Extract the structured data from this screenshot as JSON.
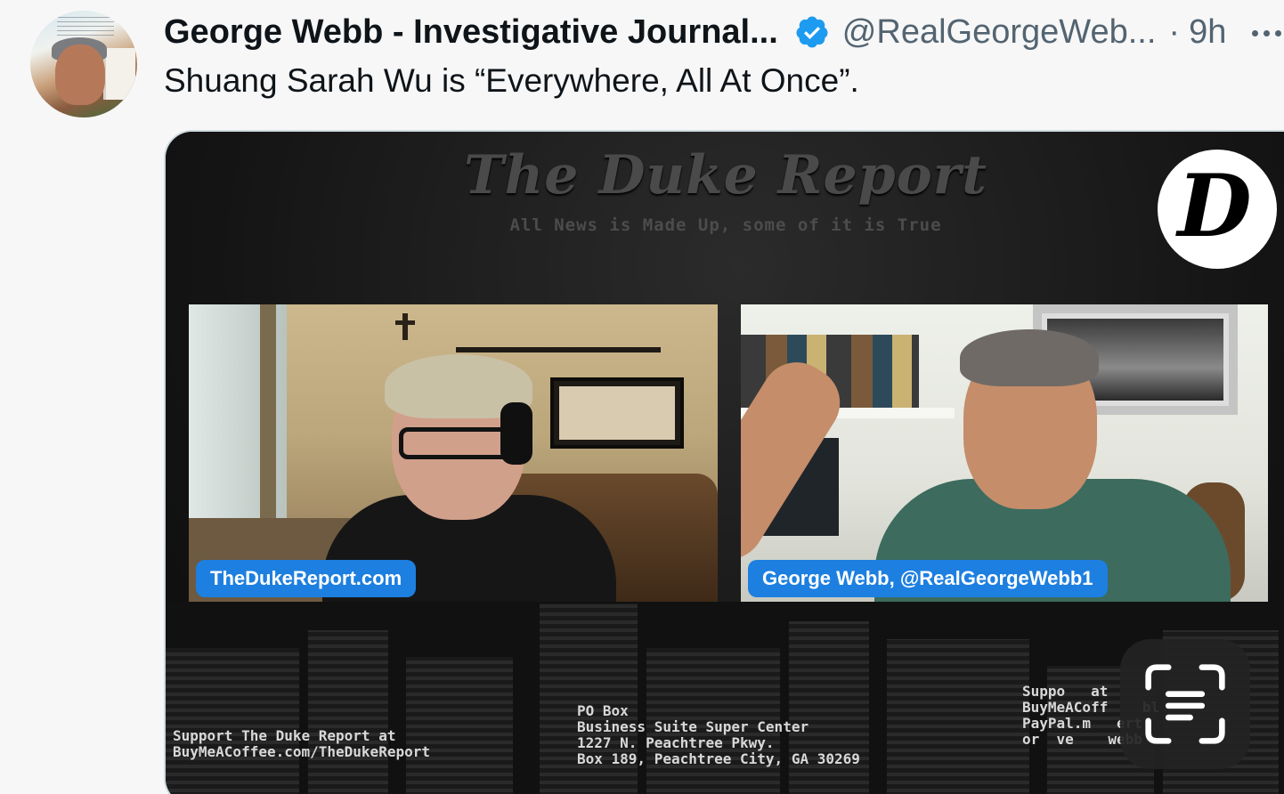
{
  "tweet": {
    "author_name": "George Webb - Investigative Journal...",
    "handle": "@RealGeorgeWeb...",
    "separator": "·",
    "time": "9h",
    "text": "Shuang Sarah Wu is “Everywhere, All At Once”."
  },
  "icons": {
    "verified": "verified-badge-icon",
    "more": "more-options-icon",
    "scan": "text-scan-icon",
    "verified_color": "#1d9bf0"
  },
  "media": {
    "show_title": "The Duke Report",
    "tagline": "All News is Made Up, some of it is True",
    "logo_letter": "D",
    "left_label": "TheDukeReport.com",
    "right_label": "George Webb, @RealGeorgeWebb1",
    "footer_left": "Support The Duke Report at\nBuyMeACoffee.com/TheDukeReport",
    "footer_mid": "PO Box\nBusiness Suite Super Center\n1227 N. Peachtree Pkwy.\nBox 189, Peachtree City, GA 30269",
    "footer_right": "Suppo   at\nBuyMeACoff    bl\nPayPal.m   ert\nor  ve    webb"
  }
}
